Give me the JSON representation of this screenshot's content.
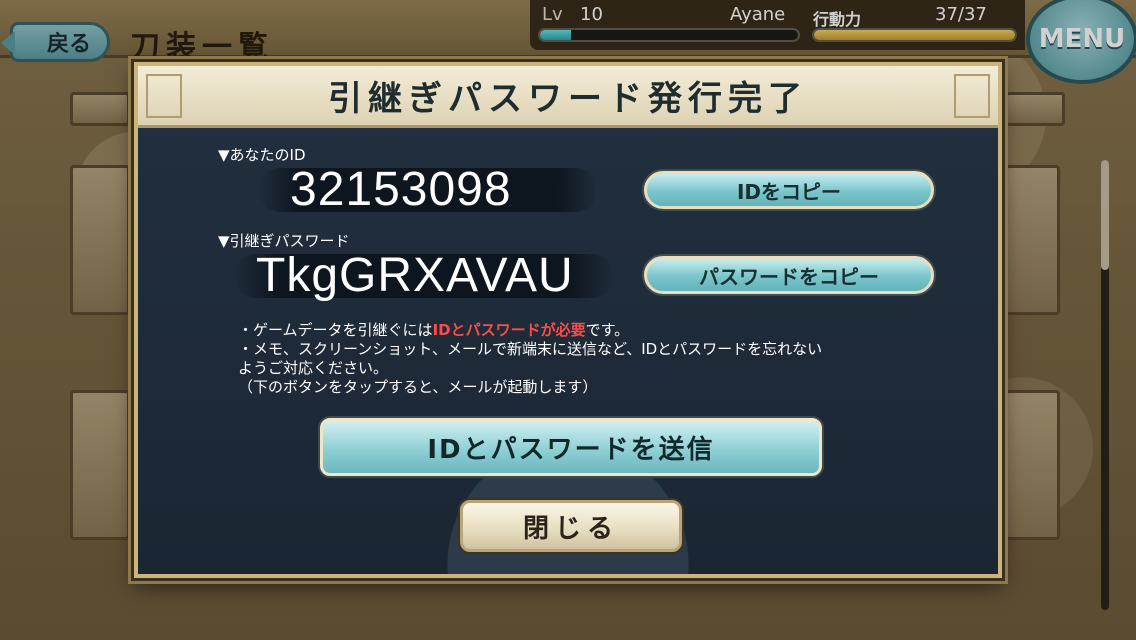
{
  "header": {
    "back_label": "戻る",
    "page_title": "刀装一覧",
    "status": {
      "lv_label": "Lv",
      "lv_value": "10",
      "player_name": "Ayane",
      "action_label": "行動力",
      "action_value": "37/37",
      "exp_progress": 0.12,
      "stamina_progress": 1.0
    },
    "menu_label": "MENU"
  },
  "modal": {
    "title": "引継ぎパスワード発行完了",
    "id_label": "▼あなたのID",
    "id_value": "32153098",
    "copy_id_label": "IDをコピー",
    "password_label": "▼引継ぎパスワード",
    "password_value": "TkgGRXAVAU",
    "copy_password_label": "パスワードをコピー",
    "notes": {
      "line1_prefix": "・ゲームデータを引継ぐには",
      "line1_highlight": "IDとパスワードが必要",
      "line1_suffix": "です。",
      "line2": "・メモ、スクリーンショット、メールで新端末に送信など、IDとパスワードを忘れない",
      "line3": "ようご対応ください。",
      "line4": "（下のボタンをタップすると、メールが起動します）"
    },
    "send_label": "IDとパスワードを送信",
    "close_label": "閉じる"
  },
  "colors": {
    "modal_bg": "#1d2a38",
    "accent_teal": "#7ac5cb",
    "highlight_red": "#ff4a4a",
    "frame_gold": "#cbb57a"
  }
}
